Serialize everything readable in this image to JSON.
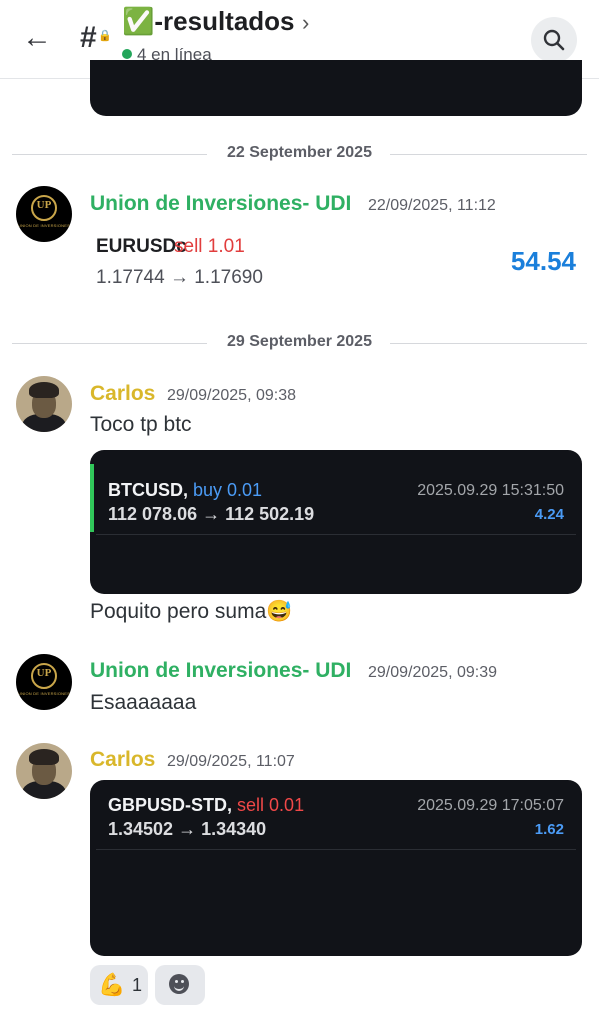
{
  "header": {
    "back_label": "←",
    "channel_icon": "hash-lock-icon",
    "channel_name": "✅-resultados",
    "chevron": "›",
    "online_text": "4 en línea",
    "search_icon": "search-icon"
  },
  "dividers": [
    "22 September 2025",
    "29 September 2025"
  ],
  "messages": [
    {
      "author": "Union de Inversiones- UDI",
      "timestamp": "22/09/2025, 11:12",
      "trade": {
        "symbol": "EURUSDc",
        "side": "sell 1.01",
        "prices": "1.17744 → 1.17690",
        "pnl": "54.54"
      }
    },
    {
      "author": "Carlos",
      "timestamp": "29/09/2025, 09:38",
      "text": "Toco tp btc",
      "card": {
        "symbol": "BTCUSD,",
        "side": "buy 0.01",
        "prices": "112 078.06 → 112 502.19",
        "datetime": "2025.09.29 15:31:50",
        "pnl": "4.24"
      },
      "text_after": "Poquito pero suma😅"
    },
    {
      "author": "Union de Inversiones- UDI",
      "timestamp": "29/09/2025, 09:39",
      "text": "Esaaaaaaa"
    },
    {
      "author": "Carlos",
      "timestamp": "29/09/2025, 11:07",
      "card": {
        "symbol": "GBPUSD-STD,",
        "side": "sell 0.01",
        "prices": "1.34502 → 1.34340",
        "datetime": "2025.09.29 17:05:07",
        "pnl": "1.62"
      },
      "reactions": [
        {
          "emoji": "💪",
          "count": "1"
        }
      ]
    }
  ],
  "avatar_udi": {
    "logo_text": "UP",
    "caption": "UNION DE INVERSIONES"
  },
  "colors": {
    "udi_name": "#2fb063",
    "carlos_name": "#d9b72b",
    "sell": "#f04848",
    "buy": "#4b9bf5",
    "pnl_blue": "#1a7fdb"
  }
}
